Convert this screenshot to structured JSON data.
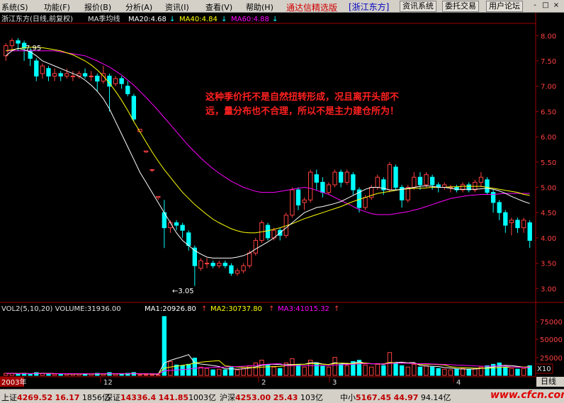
{
  "menu": {
    "items": [
      "系统(S)",
      "功能(F)",
      "报价(B)",
      "分析(A)",
      "资讯(I)",
      "查看(V)",
      "帮助(H)"
    ],
    "brand": "通达信精选版",
    "stock_tab": "[浙江东方]",
    "buttons": [
      "资讯系统",
      "委托交易",
      "用户论坛"
    ],
    "window_controls": [
      "-",
      "□",
      "×"
    ]
  },
  "price_panel": {
    "title": "浙江东方(日线,前复权)",
    "indicator": "MA季均线",
    "ma20": "MA20:4.68",
    "ma40": "MA40:4.84",
    "ma60": "MA60:4.88",
    "arrow": "↓",
    "high_marker": "7.95",
    "low_marker": "←3.05",
    "annotation_line1": "这种季价托不是自然扭转形成，况且离开头部不",
    "annotation_line2": "远，量分布也不合理，所以不是主力建仓所为！",
    "colors": {
      "ma20": "#ffffff",
      "ma40": "#ffff00",
      "ma60": "#ff00ff",
      "up": "#ff4040",
      "down": "#00ffff",
      "annotation": "#ff2020"
    }
  },
  "volume_panel": {
    "title": "VOL2(5,10,20) VOLUME:31936.00",
    "ma1": "MA1:20926.80",
    "ma2": "MA2:30737.80",
    "ma3": "MA3:41015.32",
    "arrow": "↑",
    "y_ticks": [
      "75000",
      "50000",
      "25000"
    ],
    "multiplier": "X10"
  },
  "x_axis": {
    "labels": [
      "2003年",
      "12",
      "2",
      "3",
      "4"
    ],
    "period": "日线"
  },
  "status_bar": {
    "indices": [
      {
        "name": "上证",
        "value": "4269.52",
        "change": "16.17",
        "volume": "1856亿"
      },
      {
        "name": "深证",
        "value": "14336.4",
        "change": "141.85",
        "volume": "1003亿"
      },
      {
        "name": "沪深",
        "value": "4253.00",
        "change": "25.43",
        "volume": "103亿"
      },
      {
        "name": "中小",
        "value": "5167.45",
        "change": "44.97",
        "volume": "94.14亿"
      }
    ],
    "watermark": "www.cfcn.com"
  },
  "chart_data": {
    "type": "candlestick",
    "y_axis": {
      "ticks": [
        "8.00",
        "7.50",
        "7.00",
        "6.50",
        "6.00",
        "5.50",
        "5.00",
        "4.50",
        "4.00",
        "3.50",
        "3.00"
      ],
      "ylim": [
        2.85,
        8.2
      ]
    },
    "candles": [
      [
        7.6,
        7.8,
        7.5,
        7.85
      ],
      [
        7.8,
        7.9,
        7.7,
        7.95
      ],
      [
        7.9,
        7.85,
        7.7,
        7.95
      ],
      [
        7.85,
        7.75,
        7.5,
        7.9
      ],
      [
        7.7,
        7.55,
        7.4,
        7.75
      ],
      [
        7.5,
        7.2,
        7.1,
        7.55
      ],
      [
        7.25,
        7.4,
        7.15,
        7.45
      ],
      [
        7.35,
        7.2,
        7.1,
        7.4
      ],
      [
        7.2,
        7.25,
        7.1,
        7.35
      ],
      [
        7.25,
        7.2,
        7.1,
        7.3
      ],
      [
        7.2,
        7.25,
        7.15,
        7.35
      ],
      [
        7.2,
        7.2,
        7.1,
        7.3
      ],
      [
        7.2,
        7.25,
        7.15,
        7.3
      ],
      [
        7.25,
        7.2,
        7.15,
        7.35
      ],
      [
        7.2,
        7.2,
        7.1,
        7.3
      ],
      [
        7.2,
        7.1,
        6.9,
        7.25
      ],
      [
        7.1,
        7.25,
        7.05,
        7.4
      ],
      [
        7.2,
        7.0,
        6.5,
        7.25
      ],
      [
        7.05,
        7.15,
        7.0,
        7.2
      ],
      [
        7.15,
        7.05,
        6.95,
        7.2
      ],
      [
        7.0,
        6.85,
        6.8,
        7.1
      ],
      [
        6.8,
        6.35,
        6.3,
        6.85
      ],
      [
        6.1,
        6.15,
        6.1,
        6.15
      ],
      [
        5.7,
        5.72,
        5.68,
        5.72
      ],
      [
        5.35,
        5.35,
        5.3,
        5.35
      ],
      [
        4.8,
        4.82,
        4.75,
        4.82
      ],
      [
        4.5,
        4.2,
        3.8,
        4.75
      ],
      [
        4.2,
        4.3,
        4.1,
        4.35
      ],
      [
        4.3,
        4.25,
        4.15,
        4.35
      ],
      [
        4.25,
        4.15,
        4.0,
        4.3
      ],
      [
        4.1,
        3.85,
        3.75,
        4.15
      ],
      [
        3.8,
        3.45,
        3.05,
        3.85
      ],
      [
        3.4,
        3.55,
        3.35,
        3.6
      ],
      [
        3.5,
        3.5,
        3.4,
        3.6
      ],
      [
        3.5,
        3.45,
        3.4,
        3.55
      ],
      [
        3.45,
        3.5,
        3.4,
        3.55
      ],
      [
        3.5,
        3.45,
        3.4,
        3.55
      ],
      [
        3.45,
        3.3,
        3.25,
        3.5
      ],
      [
        3.3,
        3.35,
        3.25,
        3.4
      ],
      [
        3.35,
        3.45,
        3.3,
        3.5
      ],
      [
        3.45,
        3.7,
        3.4,
        3.75
      ],
      [
        3.7,
        3.95,
        3.65,
        4.0
      ],
      [
        3.95,
        4.3,
        3.9,
        4.35
      ],
      [
        4.25,
        4.0,
        3.95,
        4.3
      ],
      [
        4.0,
        4.15,
        3.95,
        4.2
      ],
      [
        4.15,
        4.05,
        3.95,
        4.2
      ],
      [
        4.05,
        4.45,
        4.0,
        4.5
      ],
      [
        4.45,
        4.95,
        4.4,
        5.0
      ],
      [
        4.95,
        4.65,
        4.55,
        5.0
      ],
      [
        4.7,
        4.75,
        4.55,
        4.8
      ],
      [
        4.75,
        5.3,
        4.7,
        5.35
      ],
      [
        5.25,
        5.1,
        4.95,
        5.35
      ],
      [
        5.1,
        4.9,
        4.8,
        5.2
      ],
      [
        4.9,
        5.05,
        4.85,
        5.1
      ],
      [
        5.05,
        5.3,
        5.0,
        5.35
      ],
      [
        5.3,
        5.1,
        5.0,
        5.35
      ],
      [
        5.1,
        5.3,
        5.05,
        5.35
      ],
      [
        5.25,
        4.95,
        4.85,
        5.3
      ],
      [
        4.95,
        4.6,
        4.5,
        5.0
      ],
      [
        4.6,
        4.8,
        4.55,
        4.85
      ],
      [
        4.8,
        5.0,
        4.75,
        5.05
      ],
      [
        5.0,
        5.2,
        4.95,
        5.25
      ],
      [
        5.15,
        4.95,
        4.85,
        5.2
      ],
      [
        4.95,
        5.45,
        4.9,
        5.5
      ],
      [
        5.4,
        5.0,
        4.95,
        5.45
      ],
      [
        5.0,
        4.75,
        4.6,
        5.05
      ],
      [
        4.75,
        5.0,
        4.7,
        5.05
      ],
      [
        5.0,
        5.2,
        4.95,
        5.3
      ],
      [
        5.2,
        5.05,
        4.95,
        5.3
      ],
      [
        5.05,
        5.25,
        5.0,
        5.3
      ],
      [
        5.2,
        5.05,
        4.95,
        5.25
      ],
      [
        5.05,
        5.0,
        4.9,
        5.1
      ],
      [
        5.0,
        5.05,
        4.95,
        5.1
      ],
      [
        5.0,
        5.0,
        4.9,
        5.05
      ],
      [
        5.0,
        4.95,
        4.9,
        5.05
      ],
      [
        4.95,
        5.05,
        4.9,
        5.1
      ],
      [
        5.05,
        4.95,
        4.9,
        5.1
      ],
      [
        4.95,
        5.1,
        4.9,
        5.15
      ],
      [
        5.1,
        5.2,
        5.0,
        5.3
      ],
      [
        5.15,
        4.9,
        4.85,
        5.2
      ],
      [
        4.9,
        4.7,
        4.5,
        4.95
      ],
      [
        4.7,
        4.5,
        4.35,
        4.75
      ],
      [
        4.5,
        4.25,
        4.1,
        4.55
      ],
      [
        4.3,
        4.35,
        4.05,
        4.4
      ],
      [
        4.35,
        4.2,
        4.1,
        4.4
      ],
      [
        4.2,
        4.35,
        4.1,
        4.4
      ],
      [
        4.3,
        3.95,
        3.8,
        4.35
      ]
    ],
    "volume": [
      3,
      3,
      2,
      3,
      2,
      4,
      3,
      2,
      2,
      2,
      2,
      2,
      2,
      2,
      2,
      3,
      2,
      4,
      2,
      2,
      3,
      4,
      1,
      1,
      1,
      1,
      85,
      20,
      15,
      14,
      16,
      25,
      12,
      10,
      8,
      9,
      8,
      12,
      8,
      10,
      14,
      18,
      22,
      15,
      12,
      10,
      18,
      24,
      16,
      12,
      22,
      18,
      14,
      12,
      26,
      16,
      14,
      20,
      22,
      15,
      12,
      16,
      14,
      33,
      18,
      14,
      12,
      16,
      12,
      14,
      12,
      10,
      9,
      8,
      9,
      10,
      9,
      10,
      12,
      14,
      16,
      18,
      12,
      10,
      9,
      10,
      14
    ],
    "ma20": [
      7.6,
      7.7,
      7.75,
      7.72,
      7.68,
      7.6,
      7.5,
      7.45,
      7.4,
      7.35,
      7.3,
      7.25,
      7.2,
      7.12,
      7.02,
      6.9,
      6.75,
      6.55,
      6.3,
      6.05,
      5.8,
      5.55,
      5.3,
      5.1,
      4.9,
      4.7,
      4.5,
      4.3,
      4.1,
      3.95,
      3.85,
      3.75,
      3.68,
      3.62,
      3.6,
      3.6,
      3.6,
      3.6,
      3.62,
      3.65,
      3.7,
      3.78,
      3.85,
      3.92,
      4.0,
      4.1,
      4.2,
      4.3,
      4.4,
      4.5,
      4.55,
      4.6,
      4.62,
      4.65,
      4.68,
      4.72,
      4.78,
      4.84,
      4.9,
      4.96,
      5.0,
      5.0,
      4.98,
      4.95,
      4.95,
      4.96,
      4.98,
      5.0,
      5.02,
      5.03,
      5.02,
      5.0,
      5.0,
      4.98,
      4.96,
      4.96,
      4.96,
      4.96,
      4.97,
      4.98,
      4.96,
      4.93,
      4.88,
      4.82,
      4.77,
      4.72,
      4.68
    ],
    "ma40": [
      7.7,
      7.72,
      7.74,
      7.76,
      7.77,
      7.77,
      7.76,
      7.74,
      7.72,
      7.7,
      7.66,
      7.62,
      7.56,
      7.5,
      7.42,
      7.32,
      7.2,
      7.06,
      6.9,
      6.72,
      6.52,
      6.3,
      6.1,
      5.9,
      5.7,
      5.52,
      5.35,
      5.2,
      5.05,
      4.9,
      4.78,
      4.66,
      4.56,
      4.46,
      4.37,
      4.3,
      4.24,
      4.18,
      4.14,
      4.11,
      4.1,
      4.1,
      4.12,
      4.14,
      4.17,
      4.2,
      4.24,
      4.28,
      4.33,
      4.38,
      4.42,
      4.46,
      4.5,
      4.54,
      4.58,
      4.62,
      4.67,
      4.72,
      4.76,
      4.8,
      4.84,
      4.88,
      4.9,
      4.92,
      4.94,
      4.96,
      4.97,
      4.98,
      4.98,
      4.99,
      5.0,
      5.0,
      5.0,
      5.01,
      5.01,
      5.02,
      5.02,
      5.02,
      5.02,
      5.0,
      4.98,
      4.96,
      4.94,
      4.92,
      4.9,
      4.86,
      4.84
    ],
    "ma60": [
      7.7,
      7.7,
      7.7,
      7.7,
      7.7,
      7.7,
      7.7,
      7.7,
      7.7,
      7.68,
      7.66,
      7.64,
      7.62,
      7.6,
      7.55,
      7.5,
      7.44,
      7.38,
      7.3,
      7.22,
      7.12,
      7.02,
      6.9,
      6.78,
      6.65,
      6.52,
      6.38,
      6.24,
      6.1,
      5.96,
      5.82,
      5.7,
      5.58,
      5.47,
      5.37,
      5.28,
      5.2,
      5.12,
      5.06,
      5.0,
      4.96,
      4.92,
      4.9,
      4.9,
      4.9,
      4.92,
      4.94,
      4.96,
      4.98,
      5.0,
      4.98,
      4.94,
      4.9,
      4.86,
      4.8,
      4.74,
      4.68,
      4.62,
      4.56,
      4.52,
      4.48,
      4.46,
      4.46,
      4.46,
      4.48,
      4.5,
      4.52,
      4.55,
      4.58,
      4.62,
      4.66,
      4.7,
      4.74,
      4.78,
      4.8,
      4.82,
      4.84,
      4.85,
      4.86,
      4.86,
      4.86,
      4.87,
      4.88,
      4.88,
      4.88,
      4.88,
      4.88
    ]
  }
}
